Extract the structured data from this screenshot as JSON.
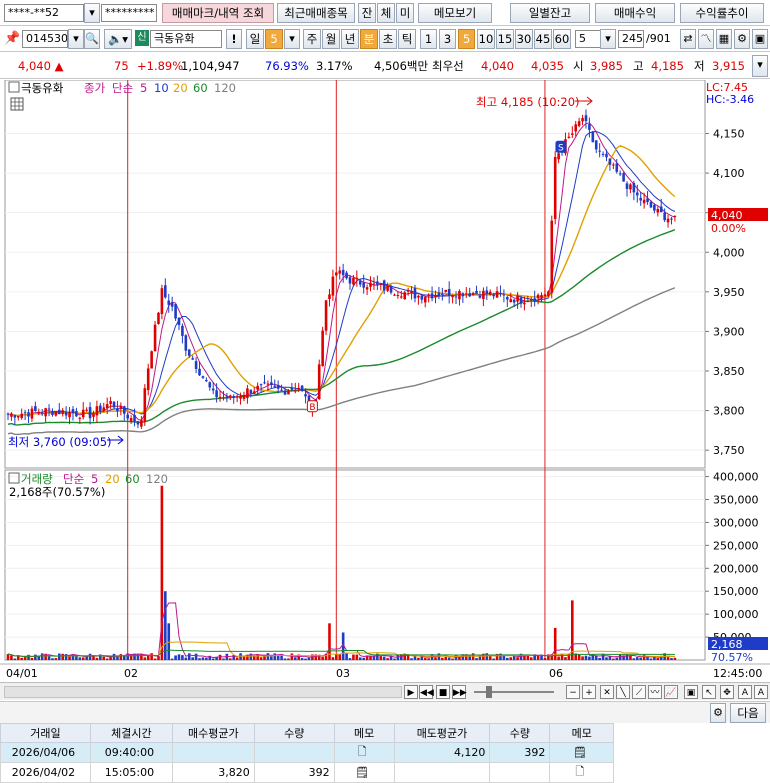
{
  "toolbar1": {
    "account": "****-**52",
    "password": "*********",
    "btn_trade_marks": "매매마크/내역 조회",
    "btn_recent_items": "최근매매종목",
    "btn_jan": "잔",
    "btn_che": "체",
    "btn_mi": "미",
    "btn_memo": "메모보기",
    "btn_daily_balance": "일별잔고",
    "btn_trade_profit": "매매수익",
    "btn_return_trend": "수익률추이"
  },
  "toolbar2": {
    "stock_code": "014530",
    "stock_badge": "신",
    "stock_name": "극동유화",
    "excl": "!",
    "period_day": "일",
    "period_value": "5",
    "periods": [
      "주",
      "월",
      "년",
      "분",
      "초",
      "틱"
    ],
    "intervals": [
      "1",
      "3",
      "5",
      "10",
      "15",
      "30",
      "45",
      "60"
    ],
    "selected_interval": "5",
    "count_value": "5",
    "bar_count": "245",
    "bar_total": "/901"
  },
  "quote": {
    "price": "4,040",
    "change": "75",
    "change_pct": "+1.89%",
    "volume": "1,104,947",
    "vol_ratio": "76.93%",
    "turnover": "3.17%",
    "amount": "4,506백만",
    "best_label": "최우선",
    "ask": "4,040",
    "bid": "4,035",
    "open_label": "시",
    "open": "3,985",
    "high_label": "고",
    "high": "4,185",
    "low_label": "저",
    "low": "3,915"
  },
  "legend": {
    "name": "극동유화",
    "series": "종가",
    "ma_type": "단순",
    "ma5": "5",
    "ma10": "10",
    "ma20": "20",
    "ma60": "60",
    "ma120": "120",
    "lc": "LC:7.45",
    "hc": "HC:-3.46"
  },
  "price_labels": {
    "current": "4,040",
    "current_pct": "0.00%",
    "high_note": "최고 4,185 (10:20)",
    "low_note": "최저 3,760 (09:05)",
    "marker_buy": "B",
    "marker_sell": "S"
  },
  "volume_legend": {
    "name": "거래량",
    "ma_type": "단순",
    "ma5": "5",
    "ma20": "20",
    "ma60": "60",
    "ma120": "120",
    "value": "2,168주(70.57%)",
    "current": "2,168",
    "current_pct": "70.57%"
  },
  "time_axis": {
    "labels": [
      "04/01",
      "02",
      "03",
      "06"
    ],
    "clock": "12:45:00"
  },
  "table": {
    "next_btn": "다음",
    "headers": [
      "거래일",
      "체결시간",
      "매수평균가",
      "수량",
      "메모",
      "매도평균가",
      "수량",
      "메모"
    ],
    "rows": [
      [
        "2026/04/06",
        "09:40:00",
        "",
        "",
        "",
        "4,120",
        "392",
        ""
      ],
      [
        "2026/04/02",
        "15:05:00",
        "3,820",
        "392",
        "",
        "",
        "",
        ""
      ]
    ]
  },
  "chart_data": {
    "type": "candlestick",
    "price_axis": {
      "ylim": [
        3730,
        4210
      ],
      "ticks": [
        3750,
        3800,
        3850,
        3900,
        3950,
        4000,
        4050,
        4100,
        4150
      ],
      "tick_labels": [
        "3,750",
        "3,800",
        "3,850",
        "3,900",
        "3,950",
        "4,000",
        "4,050",
        "4,100",
        "4,150"
      ]
    },
    "volume_axis": {
      "ylim": [
        0,
        410000
      ],
      "ticks": [
        50000,
        100000,
        150000,
        200000,
        250000,
        300000,
        350000,
        400000
      ],
      "tick_labels": [
        "50,000",
        "100,000",
        "150,000",
        "200,000",
        "250,000",
        "300,000",
        "350,000",
        "400,000"
      ]
    },
    "close_waypoints": [
      [
        0,
        3795
      ],
      [
        12,
        3800
      ],
      [
        24,
        3795
      ],
      [
        30,
        3810
      ],
      [
        36,
        3790
      ],
      [
        39,
        3785
      ],
      [
        40,
        3830
      ],
      [
        42,
        3880
      ],
      [
        45,
        3950
      ],
      [
        48,
        3930
      ],
      [
        52,
        3880
      ],
      [
        56,
        3850
      ],
      [
        60,
        3820
      ],
      [
        65,
        3815
      ],
      [
        70,
        3825
      ],
      [
        75,
        3830
      ],
      [
        80,
        3825
      ],
      [
        85,
        3830
      ],
      [
        89,
        3800
      ],
      [
        90,
        3820
      ],
      [
        93,
        3940
      ],
      [
        96,
        3975
      ],
      [
        100,
        3965
      ],
      [
        110,
        3955
      ],
      [
        120,
        3945
      ],
      [
        130,
        3950
      ],
      [
        140,
        3948
      ],
      [
        150,
        3940
      ],
      [
        155,
        3945
      ],
      [
        158,
        3950
      ],
      [
        160,
        4120
      ],
      [
        165,
        4150
      ],
      [
        168,
        4170
      ],
      [
        172,
        4130
      ],
      [
        178,
        4100
      ],
      [
        184,
        4070
      ],
      [
        190,
        4050
      ],
      [
        195,
        4040
      ]
    ],
    "volume_spikes": [
      [
        45,
        380000
      ],
      [
        46,
        150000
      ],
      [
        47,
        80000
      ],
      [
        94,
        80000
      ],
      [
        98,
        60000
      ],
      [
        160,
        70000
      ],
      [
        165,
        130000
      ]
    ],
    "buy_sell_markers": [
      {
        "type": "B",
        "date": "2026/04/02",
        "time": "15:05:00",
        "price": 3820
      },
      {
        "type": "S",
        "date": "2026/04/06",
        "time": "09:40:00",
        "price": 4120
      }
    ],
    "day_separators": [
      {
        "label": "02",
        "bar": 35
      },
      {
        "label": "03",
        "bar": 96
      },
      {
        "label": "06",
        "bar": 157
      }
    ]
  }
}
